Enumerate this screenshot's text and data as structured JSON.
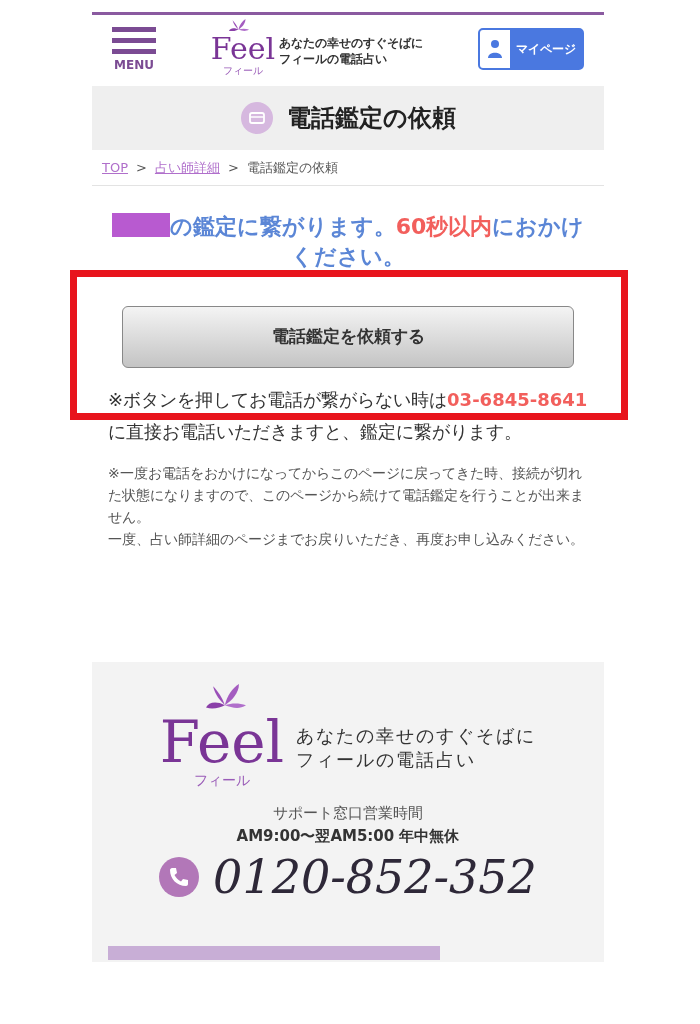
{
  "header": {
    "menu_label": "MENU",
    "logo": {
      "wordmark": "Feel",
      "kana": "フィール",
      "tagline": [
        "あなたの幸せのすぐそばに",
        "フィールの電話占い"
      ]
    },
    "mypage_label": "マイページ"
  },
  "page_title": "電話鑑定の依頼",
  "breadcrumb": [
    {
      "label": "TOP",
      "link": true
    },
    {
      "label": "占い師詳細",
      "link": true
    },
    {
      "label": "電話鑑定の依頼",
      "link": false
    }
  ],
  "breadcrumb_separator": ">",
  "message": {
    "redacted": true,
    "parts": [
      {
        "text": "の鑑定に繋がります。",
        "kind": "normal"
      },
      {
        "text": "60秒以内",
        "kind": "highlight"
      },
      {
        "text": "におかけください。",
        "kind": "normal"
      }
    ]
  },
  "request_button": "電話鑑定を依頼する",
  "note": [
    {
      "text": "※ボタンを押してお電話が繋がらない時は",
      "kind": "normal"
    },
    {
      "text": "03-6845-8641",
      "kind": "highlight"
    },
    {
      "text": "に直接お電話いただきますと、鑑定に繋がります。",
      "kind": "normal"
    }
  ],
  "notice": [
    "※一度お電話をおかけになってからこのページに戻ってきた時、接続が切れた状態になりますので、このページから続けて電話鑑定を行うことが出来ません。",
    "一度、占い師詳細のページまでお戻りいただき、再度お申し込みください。"
  ],
  "footer": {
    "logo": {
      "wordmark": "Feel",
      "kana": "フィール",
      "tagline": [
        "あなたの幸せのすぐそばに",
        "フィールの電話占い"
      ]
    },
    "hours_title": "サポート窓口営業時間",
    "hours": "AM9:00〜翌AM5:00 年中無休",
    "phone": "0120-852-352"
  },
  "highlight_frame": true
}
